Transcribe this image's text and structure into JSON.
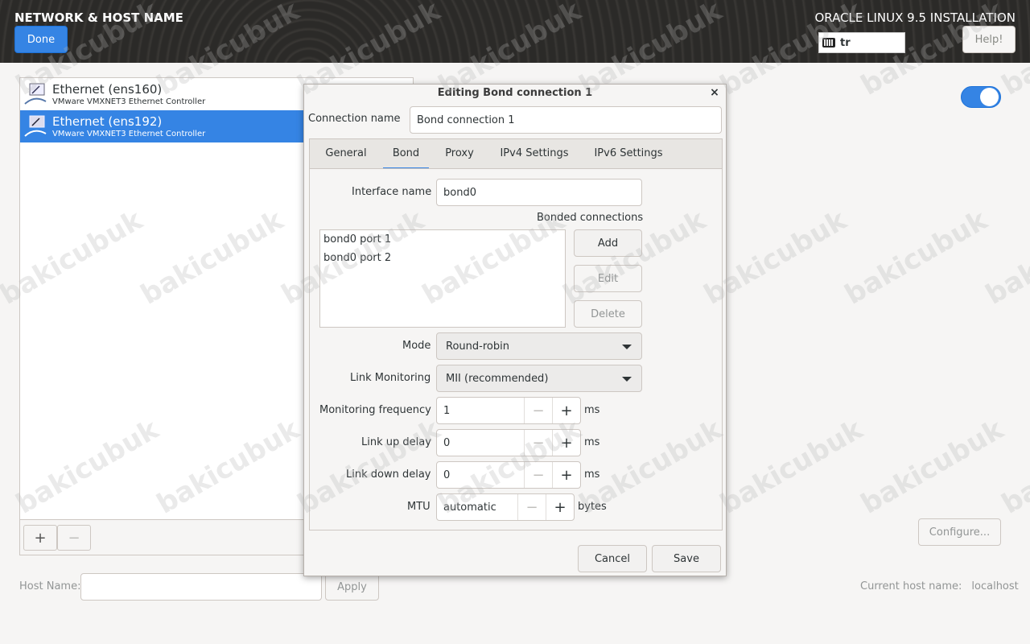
{
  "header": {
    "title": "NETWORK & HOST NAME",
    "product": "ORACLE LINUX 9.5 INSTALLATION",
    "done_label": "Done",
    "help_label": "Help!",
    "keyboard_layout": "tr"
  },
  "devices": [
    {
      "name": "Ethernet (ens160)",
      "desc": "VMware VMXNET3 Ethernet Controller"
    },
    {
      "name": "Ethernet (ens192)",
      "desc": "VMware VMXNET3 Ethernet Controller"
    }
  ],
  "list_controls": {
    "add": "+",
    "remove": "−"
  },
  "configure_label": "Configure...",
  "host": {
    "label": "Host Name:",
    "value": "",
    "apply_label": "Apply",
    "current_label": "Current host name:",
    "current_value": "localhost"
  },
  "dialog": {
    "title": "Editing Bond connection 1",
    "close": "×",
    "connection_name_label": "Connection name",
    "connection_name": "Bond connection 1",
    "tabs": [
      "General",
      "Bond",
      "Proxy",
      "IPv4 Settings",
      "IPv6 Settings"
    ],
    "active_tab": "Bond",
    "interface_name_label": "Interface name",
    "interface_name": "bond0",
    "bonded_connections_label": "Bonded connections",
    "bonded_connections": [
      "bond0 port 1",
      "bond0 port 2"
    ],
    "add_label": "Add",
    "edit_label": "Edit",
    "delete_label": "Delete",
    "mode_label": "Mode",
    "mode_value": "Round-robin",
    "link_monitoring_label": "Link Monitoring",
    "link_monitoring_value": "MII (recommended)",
    "monitoring_frequency_label": "Monitoring frequency",
    "monitoring_frequency": "1",
    "link_up_delay_label": "Link up delay",
    "link_up_delay": "0",
    "link_down_delay_label": "Link down delay",
    "link_down_delay": "0",
    "ms": "ms",
    "mtu_label": "MTU",
    "mtu_value": "automatic",
    "bytes": "bytes",
    "minus": "−",
    "plus": "+",
    "cancel_label": "Cancel",
    "save_label": "Save"
  },
  "watermark": "bakicubuk",
  "colors": {
    "accent": "#3584e4",
    "header_bg": "#2b2a28"
  }
}
